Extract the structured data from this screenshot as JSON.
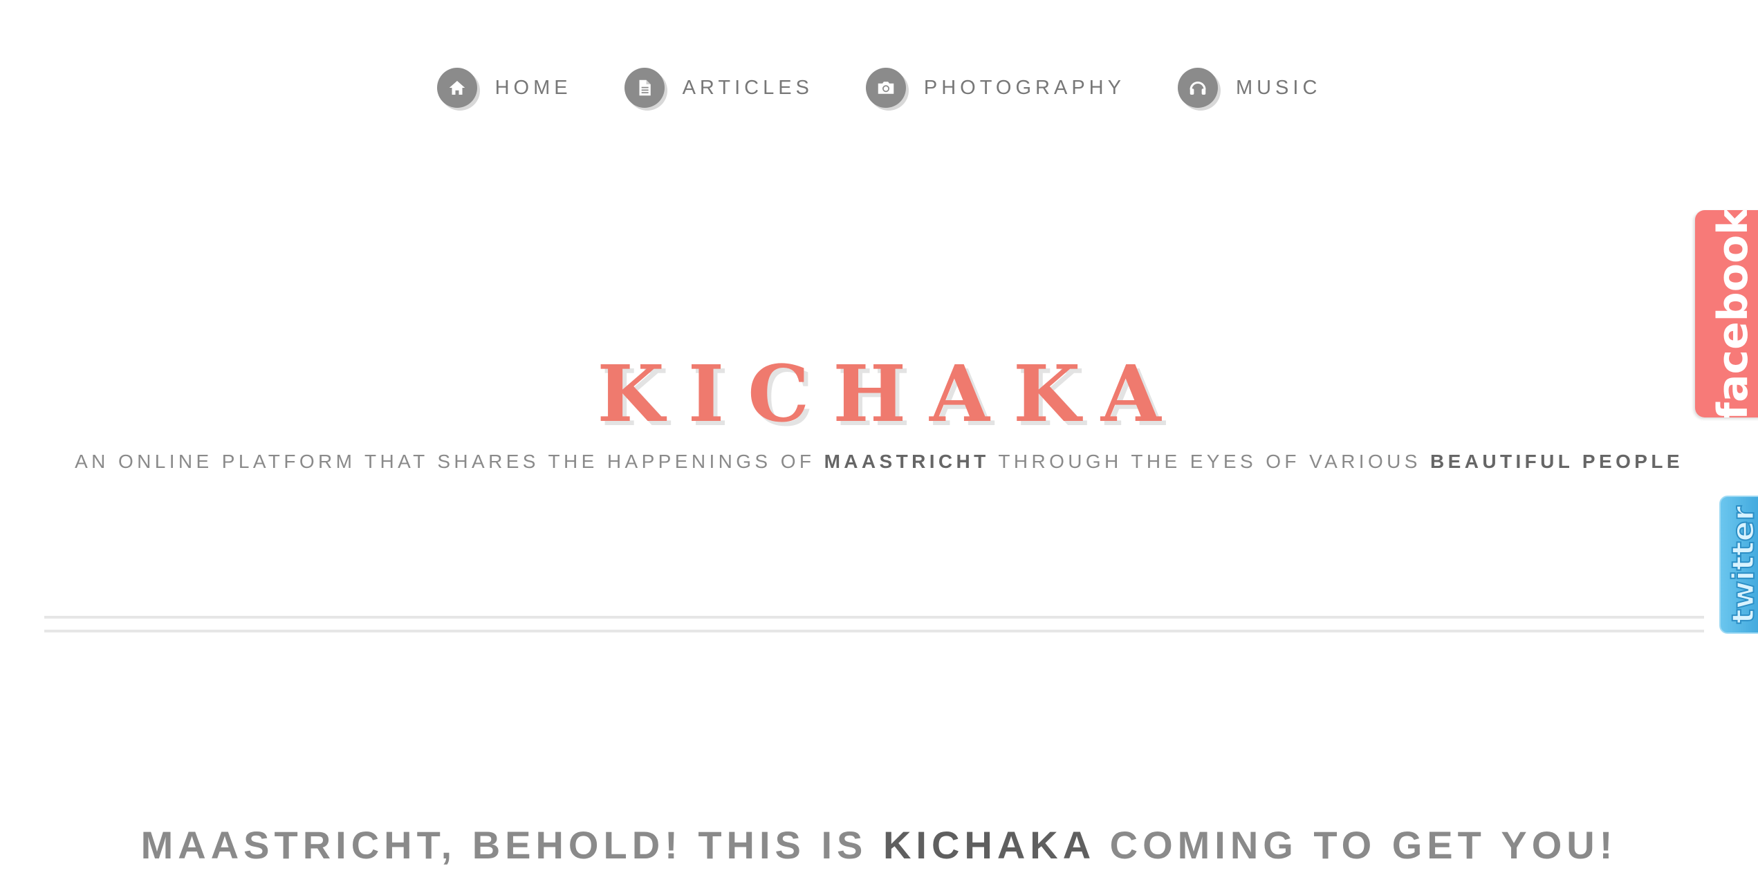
{
  "nav": {
    "items": [
      {
        "label": "HOME",
        "icon": "home-icon"
      },
      {
        "label": "ARTICLES",
        "icon": "document-icon"
      },
      {
        "label": "PHOTOGRAPHY",
        "icon": "camera-icon"
      },
      {
        "label": "MUSIC",
        "icon": "headphones-icon"
      }
    ]
  },
  "brand": {
    "title": "KICHAKA",
    "color": "#ef7a6e"
  },
  "tagline": {
    "part1": "AN ONLINE PLATFORM THAT SHARES THE HAPPENINGS OF ",
    "highlight1": "MAASTRICHT",
    "part2": " THROUGH THE EYES OF VARIOUS ",
    "highlight2": "BEAUTIFUL PEOPLE"
  },
  "headline": {
    "part1": "MAASTRICHT, BEHOLD! THIS IS ",
    "highlight": "KICHAKA",
    "part2": " COMING TO GET YOU!"
  },
  "social": {
    "facebook_label": "facebook",
    "facebook_color": "#f77a78",
    "twitter_label": "twitter",
    "twitter_color": "#3aa4db"
  }
}
